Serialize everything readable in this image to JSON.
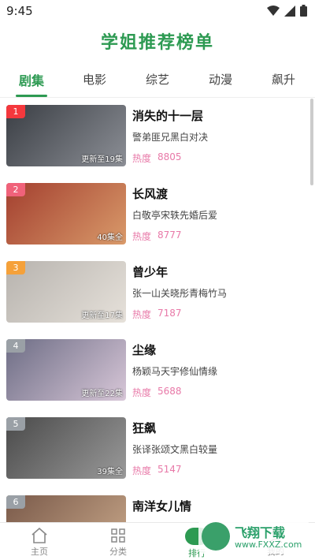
{
  "status": {
    "time": "9:45"
  },
  "header": {
    "title": "学姐推荐榜单"
  },
  "tabs": [
    {
      "label": "剧集",
      "active": true
    },
    {
      "label": "电影",
      "active": false
    },
    {
      "label": "综艺",
      "active": false
    },
    {
      "label": "动漫",
      "active": false
    },
    {
      "label": "飙升",
      "active": false
    }
  ],
  "heat_label": "热度",
  "items": [
    {
      "rank": "1",
      "title": "消失的十一层",
      "desc": "警弟匪兄黑白对决",
      "heat": "8805",
      "episode": "更新至19集",
      "rank_color": "#f4383d",
      "colors": [
        "#3a3e44",
        "#8c8f96"
      ]
    },
    {
      "rank": "2",
      "title": "长风渡",
      "desc": "白敬亭宋轶先婚后爱",
      "heat": "8777",
      "episode": "40集全",
      "rank_color": "#f0627a",
      "colors": [
        "#a33f2f",
        "#d99a6a"
      ]
    },
    {
      "rank": "3",
      "title": "曾少年",
      "desc": "张一山关晓彤青梅竹马",
      "heat": "7187",
      "episode": "更新至17集",
      "rank_color": "#f5a13a",
      "colors": [
        "#b7b3ae",
        "#e6e1da"
      ]
    },
    {
      "rank": "4",
      "title": "尘缘",
      "desc": "杨颖马天宇修仙情缘",
      "heat": "5688",
      "episode": "更新至22集",
      "rank_color": "#9aa0a6",
      "colors": [
        "#6d6d85",
        "#d8c7d8"
      ]
    },
    {
      "rank": "5",
      "title": "狂飙",
      "desc": "张译张颂文黑白较量",
      "heat": "5147",
      "episode": "39集全",
      "rank_color": "#9aa0a6",
      "colors": [
        "#4a4a4a",
        "#9a9a9a"
      ]
    },
    {
      "rank": "6",
      "title": "南洋女儿情",
      "desc": "",
      "heat": "",
      "episode": "",
      "rank_color": "#9aa0a6",
      "colors": [
        "#7a5a4a",
        "#c9a88a"
      ]
    }
  ],
  "bottom_nav": [
    {
      "label": "主页",
      "icon": "home-icon",
      "active": false
    },
    {
      "label": "分类",
      "icon": "grid-icon",
      "active": false
    },
    {
      "label": "排行",
      "icon": "rank-icon",
      "active": true
    },
    {
      "label": "我的",
      "icon": "user-icon",
      "active": false
    }
  ],
  "watermark": {
    "text": "飞翔下载",
    "url": "www.FXXZ.com"
  },
  "colors": {
    "accent": "#2d9a52",
    "heat": "#e879a8"
  }
}
